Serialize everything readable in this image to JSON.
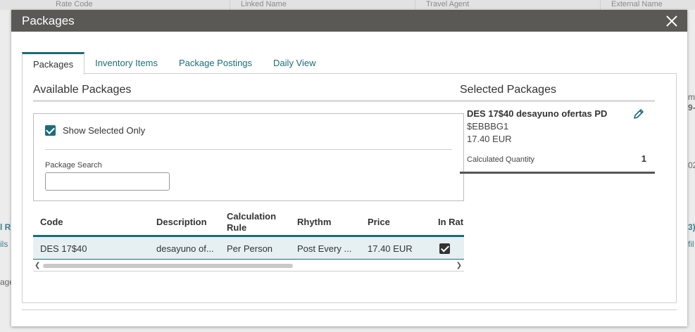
{
  "background": {
    "header_labels": [
      "Rate Code",
      "Linked Name",
      "Travel Agent",
      "External Name"
    ],
    "left_fragments": [
      "l R",
      "ils",
      "age"
    ],
    "right_fragments": [
      "mb",
      "9-",
      "02",
      "3)",
      "fil"
    ]
  },
  "modal": {
    "title": "Packages",
    "close_icon": "close-icon"
  },
  "tabs": [
    {
      "label": "Packages",
      "active": true
    },
    {
      "label": "Inventory Items",
      "active": false
    },
    {
      "label": "Package Postings",
      "active": false
    },
    {
      "label": "Daily View",
      "active": false
    }
  ],
  "available": {
    "title": "Available Packages",
    "show_selected_label": "Show Selected Only",
    "show_selected_checked": true,
    "search_label": "Package Search",
    "search_value": "",
    "search_placeholder": "",
    "columns": [
      "Code",
      "Description",
      "Calculation Rule",
      "Rhythm",
      "Price",
      "In Rat"
    ],
    "rows": [
      {
        "code": "DES 17$40",
        "description": "desayuno of...",
        "calculation_rule": "Per Person",
        "rhythm": "Post Every ...",
        "price": "17.40 EUR",
        "in_rate": true
      }
    ],
    "scroll_left_icon": "chevron-left-icon",
    "scroll_right_icon": "chevron-right-icon"
  },
  "selected": {
    "title": "Selected Packages",
    "items": [
      {
        "name": "DES 17$40  desayuno ofertas PD",
        "code": "$EBBBG1",
        "price": "17.40 EUR",
        "qty_label": "Calculated Quantity",
        "qty_value": "1"
      }
    ],
    "edit_icon": "pencil-icon"
  },
  "colors": {
    "accent": "#1b6d7a",
    "header_bg": "#5a5956",
    "row_highlight": "#e6f0f3"
  }
}
